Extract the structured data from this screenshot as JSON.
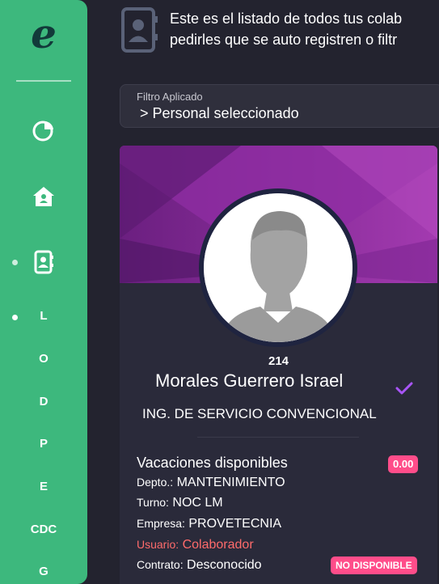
{
  "sidebar": {
    "logo_letter": "e",
    "icons": [
      "pie-chart-icon",
      "home-icon",
      "contacts-icon"
    ],
    "letters": [
      "L",
      "O",
      "D",
      "P",
      "E",
      "CDC",
      "G"
    ]
  },
  "header": {
    "line1": "Este es el listado de todos tus colab",
    "line2": "pedirles que se auto registren o filtr"
  },
  "filter": {
    "label": "Filtro Aplicado",
    "value": "> Personal seleccionado"
  },
  "card": {
    "employee_number": "214",
    "name": "Morales Guerrero Israel",
    "role": "ING. DE SERVICIO CONVENCIONAL",
    "vacations_label": "Vacaciones disponibles",
    "vacations_value": "0.00",
    "depto_label": "Depto.:",
    "depto_value": "MANTENIMIENTO",
    "turno_label": "Turno:",
    "turno_value": "NOC LM",
    "empresa_label": "Empresa:",
    "empresa_value": "PROVETECNIA",
    "usuario_label": "Usuario:",
    "usuario_value": "Colaborador",
    "contrato_label": "Contrato:",
    "contrato_value": "Desconocido",
    "status_badge": "NO DISPONIBLE"
  },
  "colors": {
    "sidebar": "#3db87d",
    "background": "#23232f",
    "card": "#2a2a3a",
    "banner": "#8e2fa0",
    "badge": "#ff4d8a",
    "check": "#a855f7",
    "usuario": "#ff6b6b"
  }
}
